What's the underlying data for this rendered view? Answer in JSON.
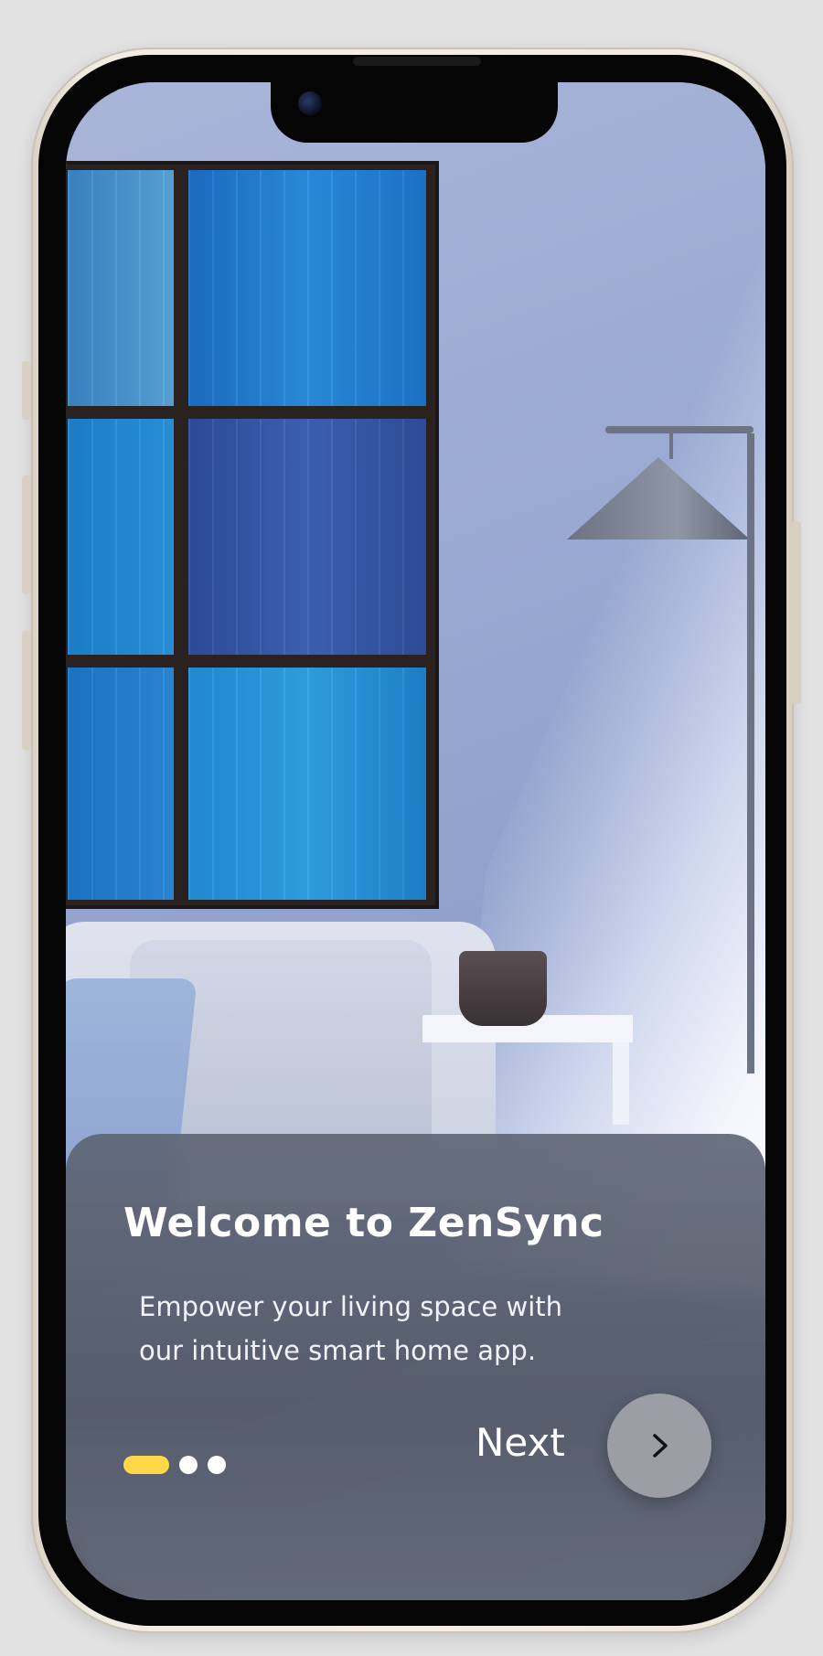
{
  "onboarding": {
    "title": "Welcome to ZenSync",
    "line1": "Empower your living space with",
    "line2": "our intuitive smart home app.",
    "next_label": "Next",
    "pagination": {
      "current": 1,
      "total": 3,
      "active_color": "#ffd84a",
      "inactive_color": "#ffffff"
    }
  },
  "icons": {
    "next_arrow": "chevron-right-icon"
  }
}
